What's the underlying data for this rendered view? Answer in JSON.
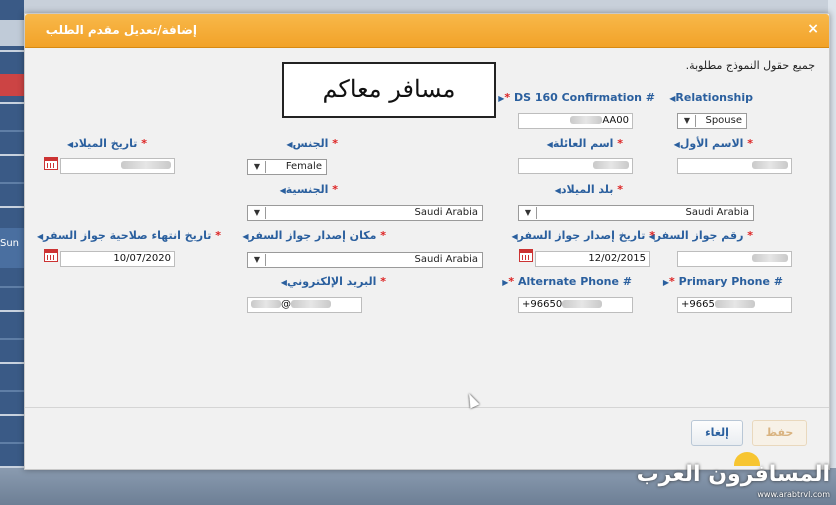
{
  "dialog": {
    "title": "إضافة/تعديل مقدم الطلب",
    "close_label": "×",
    "required_note": "جميع حقول النموذج مطلوبة.",
    "traveler_box": "مسافر معاكم"
  },
  "fields": {
    "relationship": {
      "label": "Relationship",
      "value": "Spouse"
    },
    "ds160": {
      "label": "DS 160 Confirmation #",
      "value": "AA00"
    },
    "first_name": {
      "label": "الاسم الأول"
    },
    "family_name": {
      "label": "اسم العائلة"
    },
    "gender": {
      "label": "الجنس",
      "value": "Female"
    },
    "birth_date": {
      "label": "تاريخ الميلاد"
    },
    "birth_country": {
      "label": "بلد الميلاد",
      "value": "Saudi Arabia"
    },
    "nationality": {
      "label": "الجنسية",
      "value": "Saudi Arabia"
    },
    "passport_no": {
      "label": "رقم جواز السفر"
    },
    "passport_issue_date": {
      "label": "تاريخ إصدار جواز السفر",
      "value": "12/02/2015"
    },
    "passport_issue_place": {
      "label": "مكان إصدار جواز السفر",
      "value": "Saudi Arabia"
    },
    "passport_expiry": {
      "label": "تاريخ انتهاء صلاحية جواز السفر",
      "value": "10/07/2020"
    },
    "primary_phone": {
      "label": "Primary Phone #",
      "value": "+9665"
    },
    "alternate_phone": {
      "label": "Alternate Phone #",
      "value": "+96650"
    },
    "email": {
      "label": "البريد الإلكتروني",
      "value": "@"
    }
  },
  "buttons": {
    "cancel": "إلغاء",
    "save": "حفظ"
  },
  "watermark": {
    "main": "المسافرون العرب",
    "sub": "www.arabtrvl.com"
  },
  "background": {
    "left_text": "Sun"
  }
}
